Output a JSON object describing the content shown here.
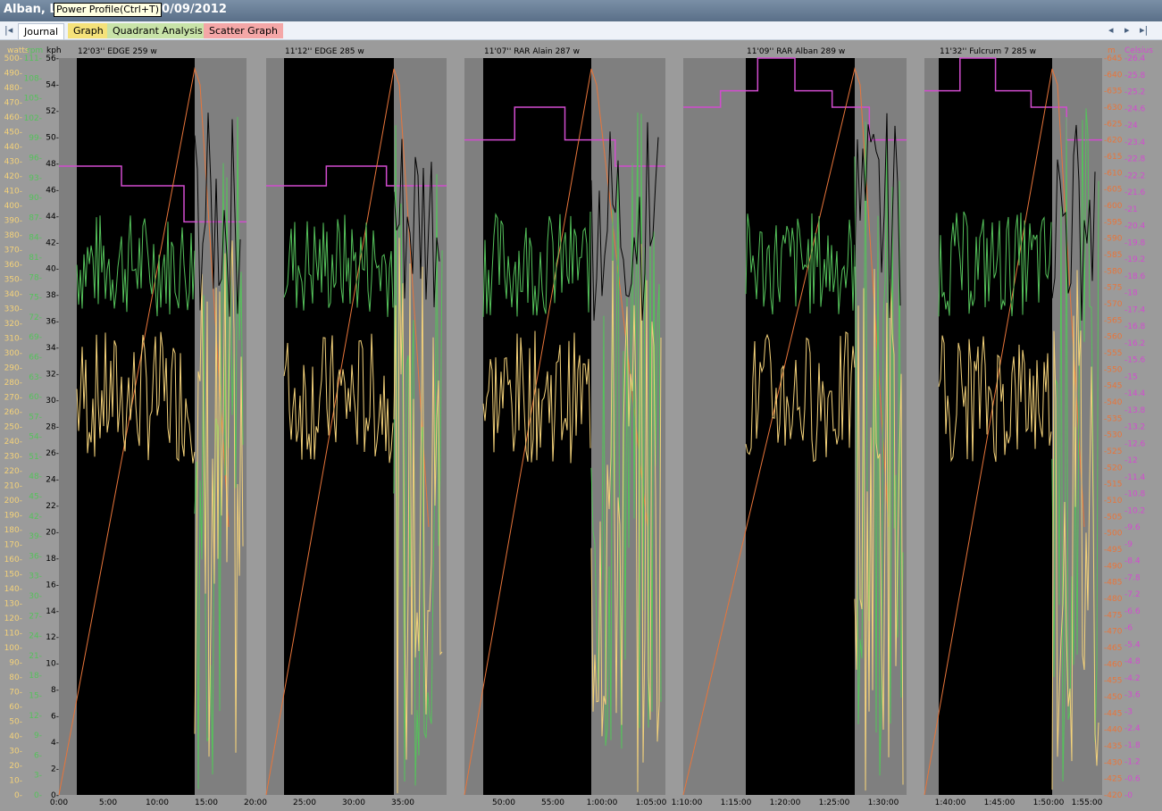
{
  "window": {
    "title_left": "Alban, L",
    "title_date": "10/09/2012",
    "tooltip": "Power Profile(Ctrl+T)"
  },
  "tabs": [
    "Journal",
    "Graph",
    "Quadrant Analysis",
    "Scatter Graph"
  ],
  "nav": {
    "first": "|◂",
    "prev": "◂",
    "next": "▸",
    "last": "▸|"
  },
  "colors": {
    "watts": "#f4d27a",
    "rpm": "#55c25b",
    "kph": "#000000",
    "altitude": "#d24ccf",
    "temperature": "#e8753a",
    "background": "#9b9b9b",
    "interval_bg": "#000000",
    "rest_bg": "#7f7f7f"
  },
  "chart_data": {
    "type": "line",
    "axes": {
      "watts": {
        "label": "watts",
        "min": 0,
        "max": 500,
        "step": 10
      },
      "rpm": {
        "label": "rpm",
        "min": 0,
        "max": 111,
        "step": 3
      },
      "kph": {
        "label": "kph",
        "min": 0,
        "max": 56,
        "step": 2
      },
      "altitude": {
        "label": "m",
        "min": 420,
        "max": 645,
        "step": 5
      },
      "temperature": {
        "label": "Celsius",
        "min": 0,
        "max": 26.4,
        "step": 0.6
      }
    },
    "x_ticks": [
      "0:00",
      "5:00",
      "10:00",
      "15:00",
      "20:00",
      "25:00",
      "30:00",
      "35:00",
      "50:00",
      "55:00",
      "1:00:00",
      "1:05:00",
      "1:10:00",
      "1:15:00",
      "1:20:00",
      "1:25:00",
      "1:30:00",
      "1:40:00",
      "1:45:00",
      "1:50:00",
      "1:55:00"
    ],
    "efforts": [
      {
        "label": "12'03'' EDGE 259 w",
        "altitude_m": [
          612,
          606,
          595
        ]
      },
      {
        "label": "11'12'' EDGE 285 w",
        "altitude_m": [
          606,
          612,
          606
        ]
      },
      {
        "label": "11'07'' RAR Alain 287 w",
        "altitude_m": [
          620,
          630,
          620,
          612
        ]
      },
      {
        "label": "11'09'' RAR Alban 289 w",
        "altitude_m": [
          630,
          635,
          645,
          635,
          630,
          620
        ]
      },
      {
        "label": "11'32'' Fulcrum 7 285 w",
        "altitude_m": [
          635,
          645,
          635,
          630,
          620
        ]
      }
    ]
  }
}
